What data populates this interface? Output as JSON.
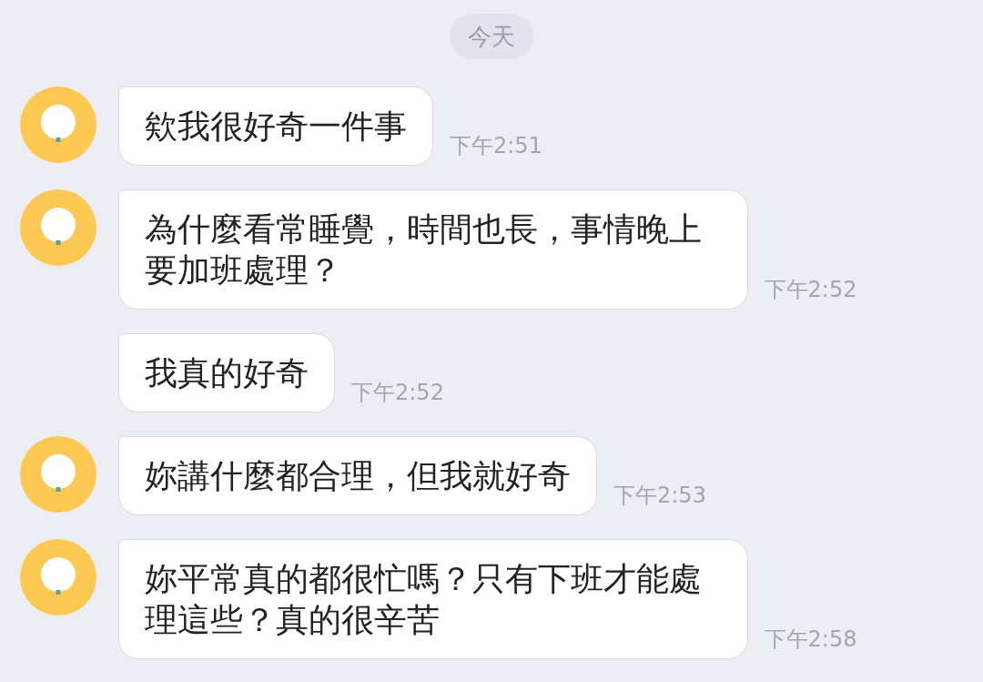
{
  "date_divider": "今天",
  "messages": [
    {
      "show_avatar": true,
      "text": "欸我很好奇一件事",
      "time": "下午2:51"
    },
    {
      "show_avatar": true,
      "text": "為什麼看常睡覺，時間也長，事情晚上要加班處理？",
      "time": "下午2:52"
    },
    {
      "show_avatar": false,
      "text": "我真的好奇",
      "time": "下午2:52"
    },
    {
      "show_avatar": true,
      "text": "妳講什麼都合理，但我就好奇",
      "time": "下午2:53"
    },
    {
      "show_avatar": true,
      "text": "妳平常真的都很忙嗎？只有下班才能處理這些？真的很辛苦",
      "time": "下午2:58"
    }
  ]
}
